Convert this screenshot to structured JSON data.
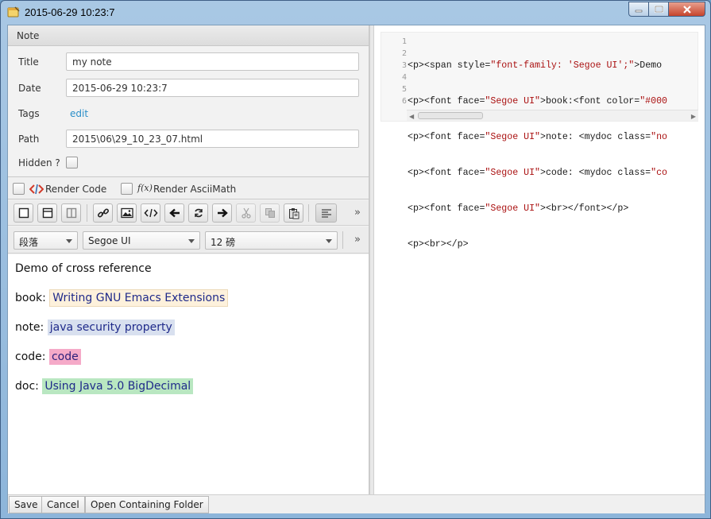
{
  "window": {
    "title": "2015-06-29 10:23:7"
  },
  "note_section": {
    "header": "Note",
    "title_label": "Title",
    "title_value": "my note",
    "date_label": "Date",
    "date_value": "2015-06-29 10:23:7",
    "tags_label": "Tags",
    "tags_link": "edit",
    "path_label": "Path",
    "path_value": "2015\\06\\29_10_23_07.html",
    "hidden_label": "Hidden ?"
  },
  "render_options": {
    "render_code_label": "Render Code",
    "render_asciimath_label": "Render AsciiMath",
    "fx_glyph": "f(x)"
  },
  "toolbar": {
    "more": "»",
    "icons": [
      "layout-single-icon",
      "layout-split-horizontal-icon",
      "layout-split-vertical-icon",
      "link-icon",
      "image-icon",
      "code-icon",
      "arrow-left-icon",
      "refresh-icon",
      "arrow-right-icon",
      "cut-icon",
      "copy-icon",
      "paste-icon",
      "align-left-icon"
    ]
  },
  "format_bar": {
    "paragraph_value": "段落",
    "font_value": "Segoe UI",
    "size_value": "12 磅",
    "more": "»"
  },
  "editor": {
    "line1": "Demo of cross reference",
    "book_label": "book: ",
    "book_value": "Writing GNU Emacs Extensions",
    "note_label": "note: ",
    "note_value": "java security property",
    "code_label": "code: ",
    "code_value": "code",
    "doc_label": "doc: ",
    "doc_value": "Using Java 5.0 BigDecimal"
  },
  "source": {
    "line_numbers": [
      "1",
      "2",
      "3",
      "4",
      "5",
      "6"
    ],
    "lines": [
      "<p><span style=\"font-family: 'Segoe UI';\">Demo",
      "<p><font face=\"Segoe UI\">book:<font color=\"#000",
      "<p><font face=\"Segoe UI\">note: <mydoc class=\"no",
      "<p><font face=\"Segoe UI\">code: <mydoc class=\"co",
      "<p><font face=\"Segoe UI\"><br></font></p>",
      "<p><br></p>"
    ]
  },
  "bottom_bar": {
    "save": "Save",
    "cancel": "Cancel",
    "open_folder": "Open Containing Folder"
  },
  "colors": {
    "link": "#2a8ec8",
    "book_highlight": "#fdf1dc",
    "note_highlight": "#d8e0ef",
    "code_highlight": "#f5aac8",
    "doc_highlight": "#b9e7c1",
    "titlebar": "#a9c8e4"
  }
}
